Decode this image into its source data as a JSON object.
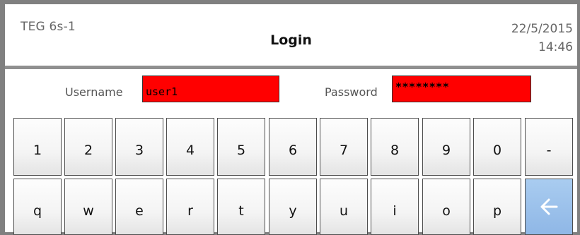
{
  "header": {
    "device": "TEG 6s-1",
    "title": "Login",
    "date": "22/5/2015",
    "time": "14:46"
  },
  "login": {
    "username_label": "Username",
    "username_value": "user1",
    "password_label": "Password",
    "password_value": "********"
  },
  "keyboard": {
    "row1": [
      "1",
      "2",
      "3",
      "4",
      "5",
      "6",
      "7",
      "8",
      "9",
      "0",
      "-"
    ],
    "row2": [
      "q",
      "w",
      "e",
      "r",
      "t",
      "y",
      "u",
      "i",
      "o",
      "p"
    ],
    "backspace_icon": "arrow-left-icon"
  },
  "colors": {
    "field_background": "#ff0000",
    "backspace_key": "#9cc1ec",
    "separator": "#909090"
  }
}
